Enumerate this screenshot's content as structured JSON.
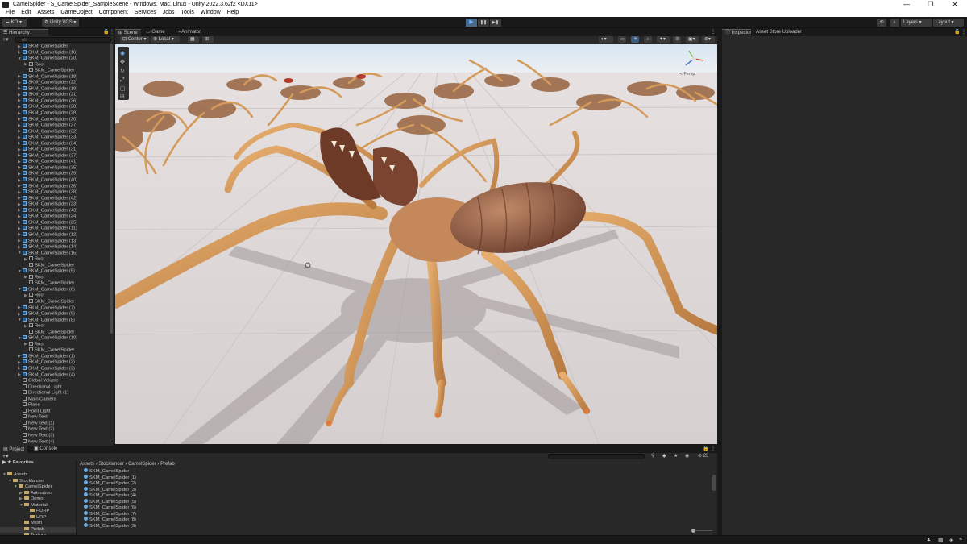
{
  "window": {
    "title": "CamelSpider - S_CamelSpider_SampleScene - Windows, Mac, Linux - Unity 2022.3.62f2 <DX11>",
    "minimize": "—",
    "maximize": "❐",
    "close": "✕"
  },
  "menu": [
    "File",
    "Edit",
    "Assets",
    "GameObject",
    "Component",
    "Services",
    "Jobs",
    "Tools",
    "Window",
    "Help"
  ],
  "toolbar": {
    "account": "KO",
    "vcs": "Unity VCS",
    "layers": "Layers",
    "layout": "Layout",
    "play": "▶",
    "pause": "❚❚",
    "step": "▶❚"
  },
  "hierarchy": {
    "tab": "Hierarchy",
    "search_placeholder": "All",
    "rows": [
      {
        "label": "SKM_CamelSpider",
        "depth": 1,
        "arrow": "▶",
        "blue": true
      },
      {
        "label": "SKM_CamelSpider (16)",
        "depth": 1,
        "arrow": "▶",
        "blue": true
      },
      {
        "label": "SKM_CamelSpider (20)",
        "depth": 1,
        "arrow": "▼",
        "blue": true
      },
      {
        "label": "Root",
        "depth": 2,
        "arrow": "▶",
        "blue": false
      },
      {
        "label": "SKM_CamelSpider",
        "depth": 2,
        "arrow": "",
        "blue": false
      },
      {
        "label": "SKM_CamelSpider (18)",
        "depth": 1,
        "arrow": "▶",
        "blue": true
      },
      {
        "label": "SKM_CamelSpider (22)",
        "depth": 1,
        "arrow": "▶",
        "blue": true
      },
      {
        "label": "SKM_CamelSpider (19)",
        "depth": 1,
        "arrow": "▶",
        "blue": true
      },
      {
        "label": "SKM_CamelSpider (21)",
        "depth": 1,
        "arrow": "▶",
        "blue": true
      },
      {
        "label": "SKM_CamelSpider (26)",
        "depth": 1,
        "arrow": "▶",
        "blue": true
      },
      {
        "label": "SKM_CamelSpider (28)",
        "depth": 1,
        "arrow": "▶",
        "blue": true
      },
      {
        "label": "SKM_CamelSpider (29)",
        "depth": 1,
        "arrow": "▶",
        "blue": true
      },
      {
        "label": "SKM_CamelSpider (30)",
        "depth": 1,
        "arrow": "▶",
        "blue": true
      },
      {
        "label": "SKM_CamelSpider (27)",
        "depth": 1,
        "arrow": "▶",
        "blue": true
      },
      {
        "label": "SKM_CamelSpider (32)",
        "depth": 1,
        "arrow": "▶",
        "blue": true
      },
      {
        "label": "SKM_CamelSpider (33)",
        "depth": 1,
        "arrow": "▶",
        "blue": true
      },
      {
        "label": "SKM_CamelSpider (34)",
        "depth": 1,
        "arrow": "▶",
        "blue": true
      },
      {
        "label": "SKM_CamelSpider (31)",
        "depth": 1,
        "arrow": "▶",
        "blue": true
      },
      {
        "label": "SKM_CamelSpider (37)",
        "depth": 1,
        "arrow": "▶",
        "blue": true
      },
      {
        "label": "SKM_CamelSpider (41)",
        "depth": 1,
        "arrow": "▶",
        "blue": true
      },
      {
        "label": "SKM_CamelSpider (35)",
        "depth": 1,
        "arrow": "▶",
        "blue": true
      },
      {
        "label": "SKM_CamelSpider (39)",
        "depth": 1,
        "arrow": "▶",
        "blue": true
      },
      {
        "label": "SKM_CamelSpider (40)",
        "depth": 1,
        "arrow": "▶",
        "blue": true
      },
      {
        "label": "SKM_CamelSpider (36)",
        "depth": 1,
        "arrow": "▶",
        "blue": true
      },
      {
        "label": "SKM_CamelSpider (38)",
        "depth": 1,
        "arrow": "▶",
        "blue": true
      },
      {
        "label": "SKM_CamelSpider (42)",
        "depth": 1,
        "arrow": "▶",
        "blue": true
      },
      {
        "label": "SKM_CamelSpider (23)",
        "depth": 1,
        "arrow": "▶",
        "blue": true
      },
      {
        "label": "SKM_CamelSpider (43)",
        "depth": 1,
        "arrow": "▶",
        "blue": true
      },
      {
        "label": "SKM_CamelSpider (24)",
        "depth": 1,
        "arrow": "▶",
        "blue": true
      },
      {
        "label": "SKM_CamelSpider (25)",
        "depth": 1,
        "arrow": "▶",
        "blue": true
      },
      {
        "label": "SKM_CamelSpider (11)",
        "depth": 1,
        "arrow": "▶",
        "blue": true
      },
      {
        "label": "SKM_CamelSpider (12)",
        "depth": 1,
        "arrow": "▶",
        "blue": true
      },
      {
        "label": "SKM_CamelSpider (13)",
        "depth": 1,
        "arrow": "▶",
        "blue": true
      },
      {
        "label": "SKM_CamelSpider (14)",
        "depth": 1,
        "arrow": "▶",
        "blue": true
      },
      {
        "label": "SKM_CamelSpider (15)",
        "depth": 1,
        "arrow": "▼",
        "blue": true
      },
      {
        "label": "Root",
        "depth": 2,
        "arrow": "▶",
        "blue": false
      },
      {
        "label": "SKM_CamelSpider",
        "depth": 2,
        "arrow": "",
        "blue": false
      },
      {
        "label": "SKM_CamelSpider (5)",
        "depth": 1,
        "arrow": "▼",
        "blue": true
      },
      {
        "label": "Root",
        "depth": 2,
        "arrow": "▶",
        "blue": false
      },
      {
        "label": "SKM_CamelSpider",
        "depth": 2,
        "arrow": "",
        "blue": false
      },
      {
        "label": "SKM_CamelSpider (6)",
        "depth": 1,
        "arrow": "▼",
        "blue": true
      },
      {
        "label": "Root",
        "depth": 2,
        "arrow": "▶",
        "blue": false
      },
      {
        "label": "SKM_CamelSpider",
        "depth": 2,
        "arrow": "",
        "blue": false
      },
      {
        "label": "SKM_CamelSpider (7)",
        "depth": 1,
        "arrow": "▶",
        "blue": true
      },
      {
        "label": "SKM_CamelSpider (9)",
        "depth": 1,
        "arrow": "▶",
        "blue": true
      },
      {
        "label": "SKM_CamelSpider (8)",
        "depth": 1,
        "arrow": "▼",
        "blue": true
      },
      {
        "label": "Root",
        "depth": 2,
        "arrow": "▶",
        "blue": false
      },
      {
        "label": "SKM_CamelSpider",
        "depth": 2,
        "arrow": "",
        "blue": false
      },
      {
        "label": "SKM_CamelSpider (10)",
        "depth": 1,
        "arrow": "▼",
        "blue": true
      },
      {
        "label": "Root",
        "depth": 2,
        "arrow": "▶",
        "blue": false
      },
      {
        "label": "SKM_CamelSpider",
        "depth": 2,
        "arrow": "",
        "blue": false
      },
      {
        "label": "SKM_CamelSpider (1)",
        "depth": 1,
        "arrow": "▶",
        "blue": true
      },
      {
        "label": "SKM_CamelSpider (2)",
        "depth": 1,
        "arrow": "▶",
        "blue": true
      },
      {
        "label": "SKM_CamelSpider (3)",
        "depth": 1,
        "arrow": "▶",
        "blue": true
      },
      {
        "label": "SKM_CamelSpider (4)",
        "depth": 1,
        "arrow": "▶",
        "blue": true
      },
      {
        "label": "Global Volume",
        "depth": 1,
        "arrow": "",
        "blue": false
      },
      {
        "label": "Directional Light",
        "depth": 1,
        "arrow": "",
        "blue": false
      },
      {
        "label": "Directional Light (1)",
        "depth": 1,
        "arrow": "",
        "blue": false
      },
      {
        "label": "Main Camera",
        "depth": 1,
        "arrow": "",
        "blue": false
      },
      {
        "label": "Plane",
        "depth": 1,
        "arrow": "",
        "blue": false
      },
      {
        "label": "Point Light",
        "depth": 1,
        "arrow": "",
        "blue": false
      },
      {
        "label": "New Text",
        "depth": 1,
        "arrow": "",
        "blue": false
      },
      {
        "label": "New Text (1)",
        "depth": 1,
        "arrow": "",
        "blue": false
      },
      {
        "label": "New Text (2)",
        "depth": 1,
        "arrow": "",
        "blue": false
      },
      {
        "label": "New Text (3)",
        "depth": 1,
        "arrow": "",
        "blue": false
      },
      {
        "label": "New Text (4)",
        "depth": 1,
        "arrow": "",
        "blue": false
      }
    ]
  },
  "scene": {
    "tabs": [
      "Scene",
      "Game",
      "Animator"
    ],
    "pivot": "Center",
    "space": "Local",
    "persp_label": "< Persp"
  },
  "inspector": {
    "tabs": [
      "Inspector",
      "Asset Store Uploader"
    ]
  },
  "project": {
    "tabs": [
      "Project",
      "Console"
    ],
    "favorites": "Favorites",
    "breadcrumb": [
      "Assets",
      "Stocklancer",
      "CamelSpider",
      "Prefab"
    ],
    "count": "23",
    "tree": [
      {
        "label": "Assets",
        "depth": 0,
        "arrow": "▼"
      },
      {
        "label": "Stocklancer",
        "depth": 1,
        "arrow": "▼"
      },
      {
        "label": "CamelSpider",
        "depth": 2,
        "arrow": "▼"
      },
      {
        "label": "Animation",
        "depth": 3,
        "arrow": "▶"
      },
      {
        "label": "Demo",
        "depth": 3,
        "arrow": "▶"
      },
      {
        "label": "Material",
        "depth": 3,
        "arrow": "▼"
      },
      {
        "label": "HDRP",
        "depth": 4,
        "arrow": ""
      },
      {
        "label": "URP",
        "depth": 4,
        "arrow": ""
      },
      {
        "label": "Mesh",
        "depth": 3,
        "arrow": ""
      },
      {
        "label": "Prefab",
        "depth": 3,
        "arrow": "",
        "selected": true
      },
      {
        "label": "Texture",
        "depth": 3,
        "arrow": ""
      }
    ],
    "assets": [
      "SKM_CamelSpider",
      "SKM_CamelSpider (1)",
      "SKM_CamelSpider (2)",
      "SKM_CamelSpider (3)",
      "SKM_CamelSpider (4)",
      "SKM_CamelSpider (5)",
      "SKM_CamelSpider (6)",
      "SKM_CamelSpider (7)",
      "SKM_CamelSpider (8)",
      "SKM_CamelSpider (9)"
    ]
  },
  "colors": {
    "editor_bg": "#191919",
    "panel_bg": "#282828",
    "floor": "#ddd6d6",
    "spider_body": "#c98d55",
    "spider_dark": "#7a4a30"
  }
}
